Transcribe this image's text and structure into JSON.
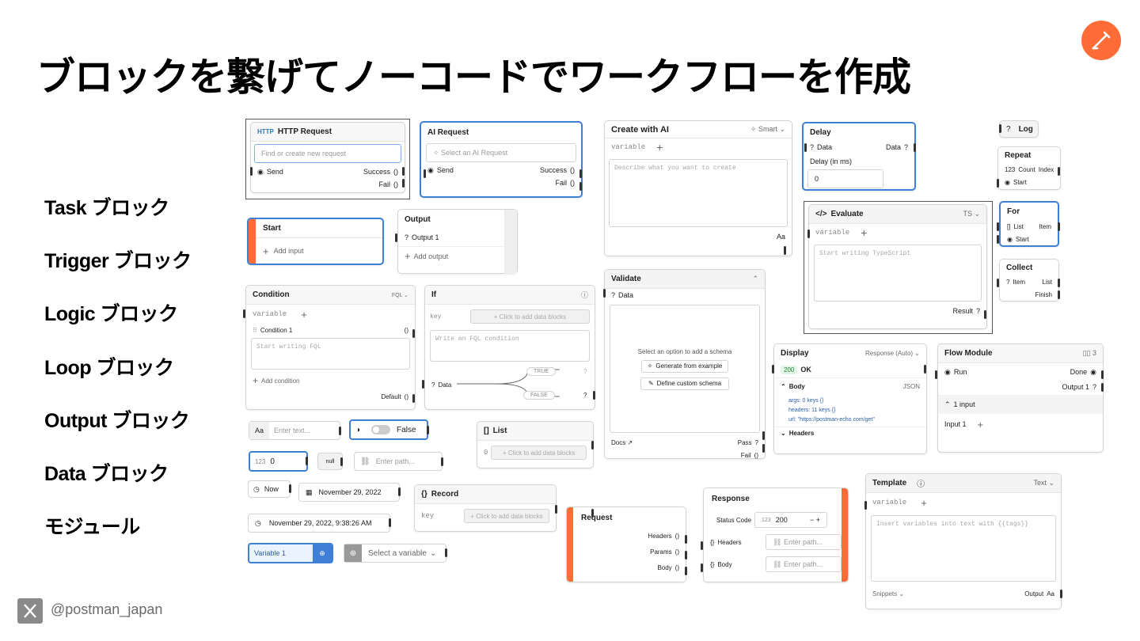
{
  "title": "ブロックを繋げてノーコードでワークフローを作成",
  "categories": [
    "Task ブロック",
    "Trigger ブロック",
    "Logic ブロック",
    "Loop ブロック",
    "Output ブロック",
    "Data ブロック",
    "モジュール"
  ],
  "footer": {
    "handle": "@postman_japan"
  },
  "http": {
    "title": "HTTP Request",
    "placeholder": "Find or create new request",
    "send": "Send",
    "success": "Success",
    "fail": "Fail",
    "paren": "()"
  },
  "ai": {
    "title": "AI Request",
    "placeholder": "Select an AI Request",
    "send": "Send",
    "success": "Success",
    "fail": "Fail"
  },
  "create": {
    "title": "Create with AI",
    "mode": "Smart",
    "variable": "variable",
    "placeholder": "Describe what you want to create",
    "aa": "Aa"
  },
  "delay": {
    "title": "Delay",
    "data_in": "Data",
    "data_out": "Data",
    "label": "Delay (in ms)",
    "value": "0"
  },
  "log": {
    "title": "Log"
  },
  "repeat": {
    "title": "Repeat",
    "count": "Count",
    "index": "Index",
    "start": "Start"
  },
  "for": {
    "title": "For",
    "list": "List",
    "item": "Item",
    "start": "Start"
  },
  "collect": {
    "title": "Collect",
    "item": "Item",
    "list": "List",
    "finish": "Finish"
  },
  "evaluate": {
    "title": "Evaluate",
    "variable": "variable",
    "placeholder": "Start writing TypeScript",
    "result": "Result"
  },
  "start": {
    "title": "Start",
    "add": "Add input"
  },
  "output": {
    "title": "Output",
    "item": "Output 1",
    "add": "Add output"
  },
  "condition": {
    "title": "Condition",
    "lang": "FQL",
    "variable": "variable",
    "cond": "Condition 1",
    "placeholder": "Start writing FQL",
    "add": "Add condition",
    "default": "Default"
  },
  "if": {
    "title": "If",
    "key": "key",
    "add": "+ Click to add data blocks",
    "placeholder": "Write an FQL condition",
    "data": "Data",
    "true": "TRUE",
    "false": "FALSE"
  },
  "validate": {
    "title": "Validate",
    "data": "Data",
    "prompt": "Select an option to add a schema",
    "gen": "Generate from example",
    "define": "Define custom schema",
    "docs": "Docs ↗",
    "pass": "Pass",
    "fail": "Fail"
  },
  "display": {
    "title": "Display",
    "mode": "Response (Auto)",
    "code": "200",
    "ok": "OK",
    "body": "Body",
    "fmt": "JSON",
    "args": "args: 0 keys {}",
    "headers": "headers: 11 keys {}",
    "url": "url: \"https://postman-echo.com/get\"",
    "headers_section": "Headers"
  },
  "flow": {
    "title": "Flow Module",
    "count": "3",
    "run": "Run",
    "done": "Done",
    "out": "Output 1",
    "inputs": "1 input",
    "in1": "Input 1"
  },
  "data": {
    "text_label": "Aa",
    "text_ph": "Enter text...",
    "bool": "False",
    "num_label": "123",
    "num": "0",
    "null": "null",
    "path_ph": "Enter path...",
    "now": "Now",
    "date": "November 29, 2022",
    "datetime": "November 29, 2022, 9:38:26 AM",
    "var": "Variable 1",
    "select_var": "Select a variable"
  },
  "list": {
    "title": "List",
    "idx": "0",
    "add": "+ Click to add data blocks"
  },
  "record": {
    "title": "Record",
    "key": "key",
    "add": "+ Click to add data blocks"
  },
  "request": {
    "title": "Request",
    "headers": "Headers",
    "params": "Params",
    "body": "Body"
  },
  "response": {
    "title": "Response",
    "status": "Status Code",
    "num": "123",
    "value": "200",
    "headers": "Headers",
    "body": "Body",
    "ph": "Enter path..."
  },
  "template": {
    "title": "Template",
    "mode": "Text",
    "variable": "variable",
    "placeholder": "Insert variables into text with {{tags}}",
    "snippets": "Snippets",
    "output": "Output",
    "aa": "Aa"
  }
}
